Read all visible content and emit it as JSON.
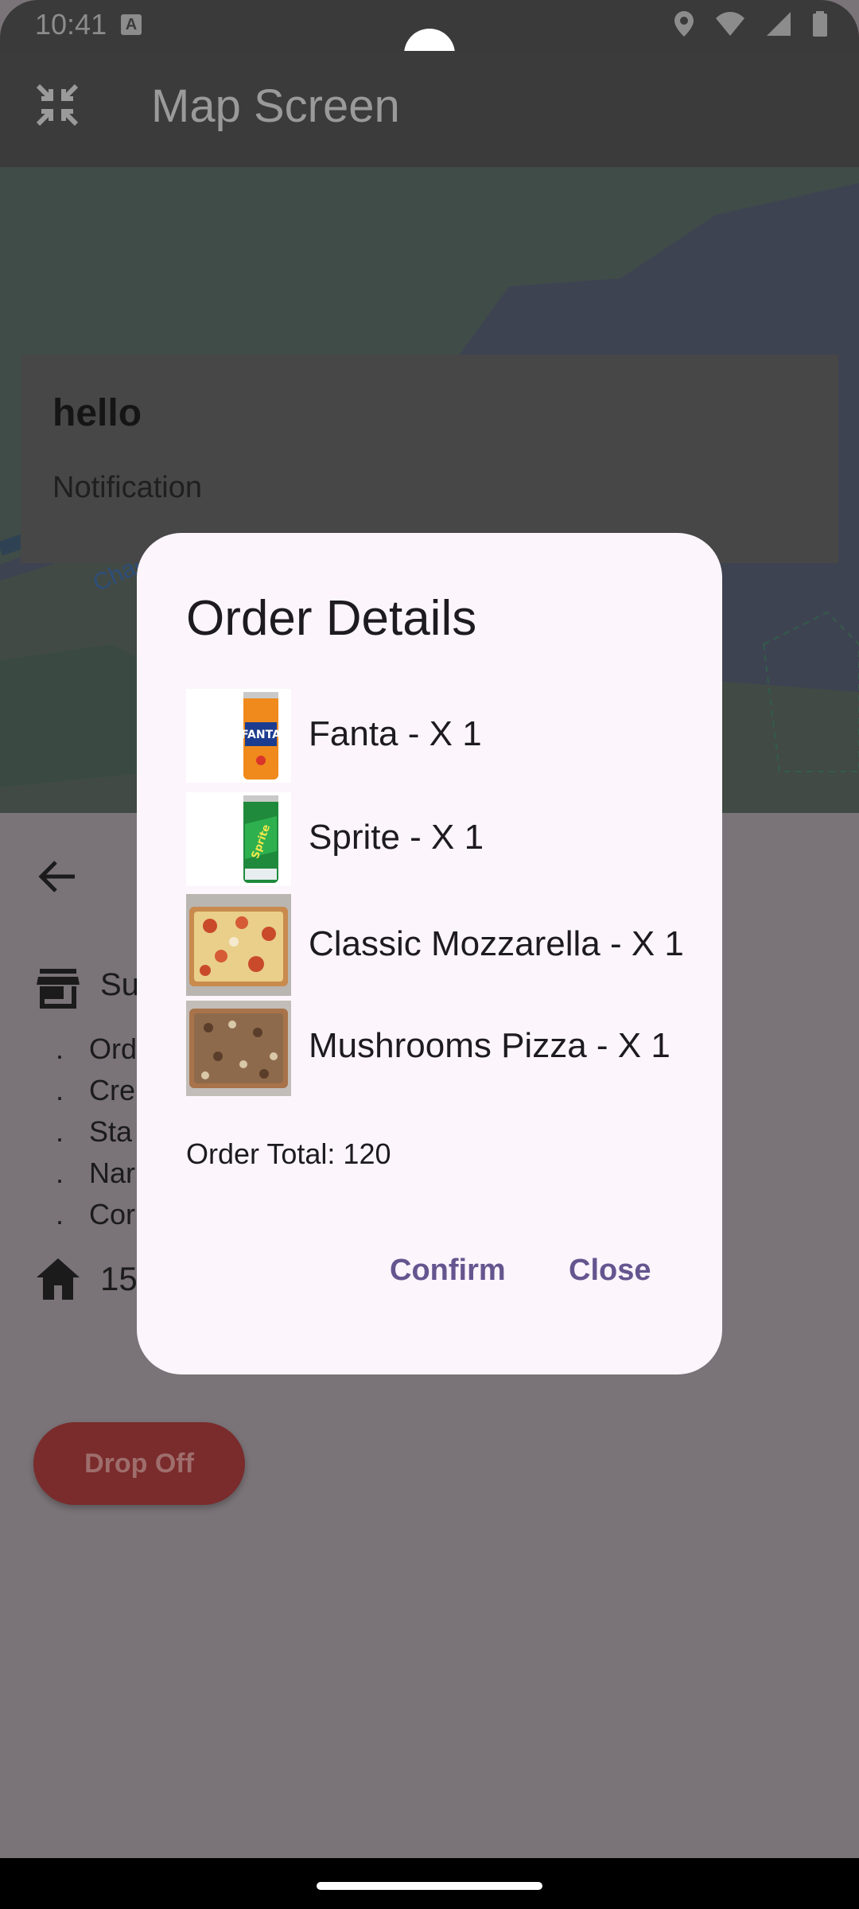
{
  "status_bar": {
    "time": "10:41",
    "notification_badge": "A"
  },
  "app_bar": {
    "title": "Map Screen",
    "leading_icon": "collapse-icon"
  },
  "map": {
    "place_label": "Charleston Slou"
  },
  "notification": {
    "title": "hello",
    "body": "Notification"
  },
  "sheet": {
    "store_name": "Su",
    "details": [
      "Ord",
      "Cre",
      "Sta",
      "Nar",
      "Cor"
    ],
    "detail_bullet": ".",
    "address": "15",
    "dropoff_label": "Drop Off"
  },
  "dialog": {
    "title": "Order Details",
    "items": [
      {
        "label": "Fanta - X 1",
        "thumb": "fanta-can"
      },
      {
        "label": "Sprite - X 1",
        "thumb": "sprite-can"
      },
      {
        "label": "Classic Mozzarella - X 1",
        "thumb": "mozzarella-pizza"
      },
      {
        "label": "Mushrooms Pizza - X 1",
        "thumb": "mushroom-pizza"
      }
    ],
    "total": "Order Total: 120",
    "confirm_label": "Confirm",
    "close_label": "Close"
  },
  "colors": {
    "dialog_bg": "#fcf5fc",
    "dialog_button": "#65558f",
    "scrim": "#7a7377",
    "dropoff_button": "#7a2b2b"
  }
}
